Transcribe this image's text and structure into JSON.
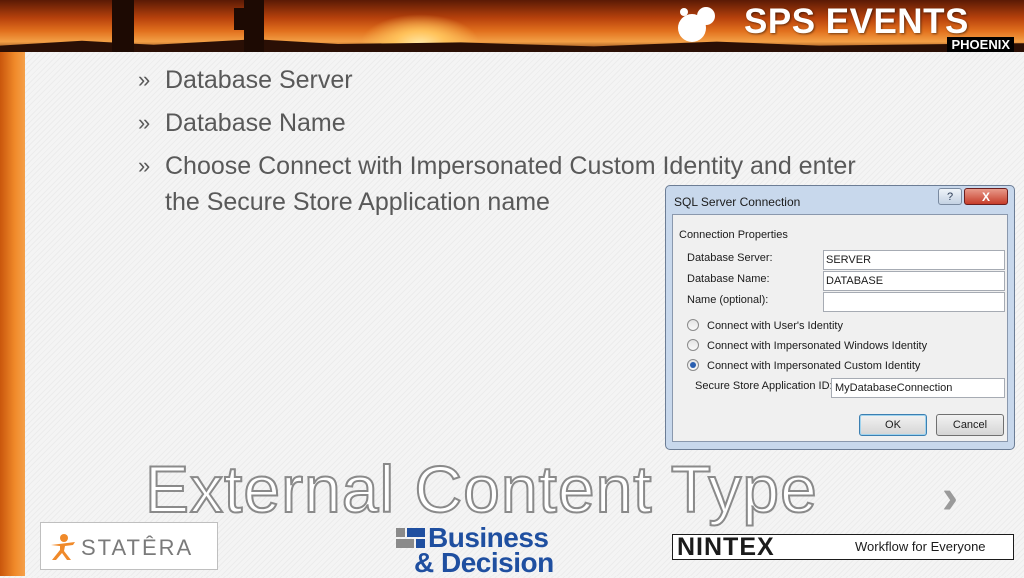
{
  "header": {
    "logo_main": "SPS EVENTS",
    "logo_sub": "PHOENIX"
  },
  "bullets": [
    {
      "marker": "»",
      "text": "Database Server"
    },
    {
      "marker": "»",
      "text": "Database Name"
    },
    {
      "marker": "»",
      "text": "Choose Connect with Impersonated Custom Identity and enter the Secure Store Application name"
    }
  ],
  "dialog": {
    "title": "SQL Server Connection",
    "help_label": "?",
    "close_label": "X",
    "group_label": "Connection Properties",
    "fields": [
      {
        "label": "Database Server:",
        "value": "SERVER"
      },
      {
        "label": "Database Name:",
        "value": "DATABASE"
      },
      {
        "label": "Name (optional):",
        "value": ""
      }
    ],
    "radios": [
      {
        "label": "Connect with User's Identity",
        "selected": false
      },
      {
        "label": "Connect with Impersonated Windows Identity",
        "selected": false
      },
      {
        "label": "Connect with Impersonated Custom Identity",
        "selected": true
      }
    ],
    "secure_store_label": "Secure Store Application ID:",
    "secure_store_value": "MyDatabaseConnection",
    "ok_label": "OK",
    "cancel_label": "Cancel"
  },
  "slide_title": "External Content Type",
  "next_icon": "chevron-right-icon",
  "sponsors": {
    "statera": "STATÊRA",
    "bd_line1": "Business",
    "bd_line2": "& Decision",
    "nintex_word": "NINTEX",
    "nintex_tag": "Workflow for Everyone"
  },
  "colors": {
    "accent_orange": "#f08a2a",
    "text_gray": "#595959",
    "bd_blue": "#1f4fa0"
  }
}
